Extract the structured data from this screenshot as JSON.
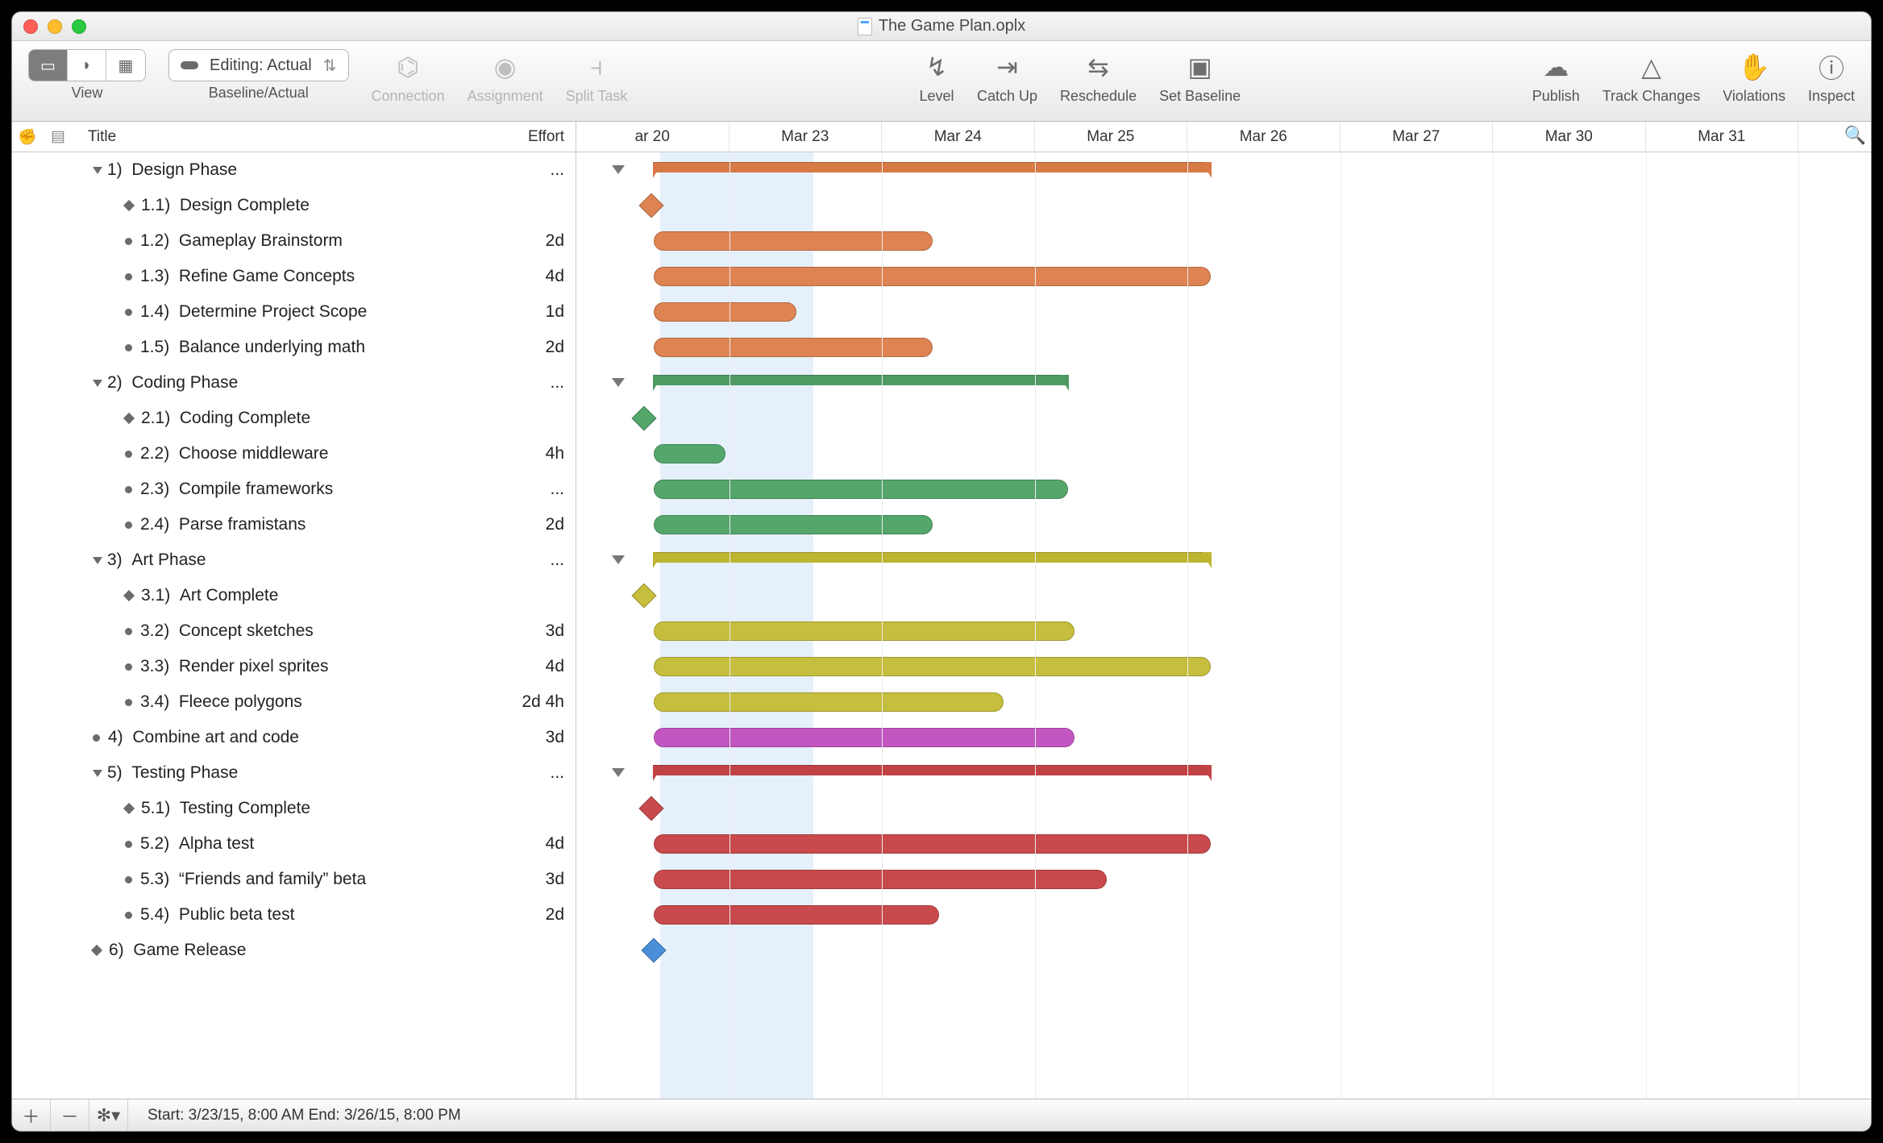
{
  "window_title": "The Game Plan.oplx",
  "toolbar": {
    "view_label": "View",
    "baseline_label": "Baseline/Actual",
    "dropdown_value": "Editing: Actual",
    "connection": "Connection",
    "assignment": "Assignment",
    "split": "Split Task",
    "level": "Level",
    "catch": "Catch Up",
    "reschedule": "Reschedule",
    "setbase": "Set Baseline",
    "publish": "Publish",
    "track": "Track Changes",
    "violations": "Violations",
    "inspect": "Inspect"
  },
  "columns": {
    "title": "Title",
    "effort": "Effort"
  },
  "dates": [
    "ar 20",
    "Mar 23",
    "Mar 24",
    "Mar 25",
    "Mar 26",
    "Mar 27",
    "Mar 30",
    "Mar 31"
  ],
  "tasks": [
    {
      "n": "1)",
      "t": "Design Phase",
      "eff": "...",
      "type": "group",
      "lvl": 0,
      "color": "orange",
      "start": 0.06,
      "end": 0.49
    },
    {
      "n": "1.1)",
      "t": "Design Complete",
      "eff": "",
      "type": "milestone",
      "lvl": 1,
      "color": "orange",
      "start": 0.058
    },
    {
      "n": "1.2)",
      "t": "Gameplay Brainstorm",
      "eff": "2d",
      "type": "task",
      "lvl": 1,
      "color": "orange",
      "start": 0.06,
      "end": 0.275
    },
    {
      "n": "1.3)",
      "t": "Refine Game Concepts",
      "eff": "4d",
      "type": "task",
      "lvl": 1,
      "color": "orange",
      "start": 0.06,
      "end": 0.49
    },
    {
      "n": "1.4)",
      "t": "Determine Project Scope",
      "eff": "1d",
      "type": "task",
      "lvl": 1,
      "color": "orange",
      "start": 0.06,
      "end": 0.17
    },
    {
      "n": "1.5)",
      "t": "Balance underlying math",
      "eff": "2d",
      "type": "task",
      "lvl": 1,
      "color": "orange",
      "start": 0.06,
      "end": 0.275
    },
    {
      "n": "2)",
      "t": "Coding Phase",
      "eff": "...",
      "type": "group",
      "lvl": 0,
      "color": "green",
      "start": 0.06,
      "end": 0.38
    },
    {
      "n": "2.1)",
      "t": "Coding Complete",
      "eff": "",
      "type": "milestone",
      "lvl": 1,
      "color": "green",
      "start": 0.052
    },
    {
      "n": "2.2)",
      "t": "Choose middleware",
      "eff": "4h",
      "type": "task",
      "lvl": 1,
      "color": "green",
      "start": 0.06,
      "end": 0.115
    },
    {
      "n": "2.3)",
      "t": "Compile frameworks",
      "eff": "...",
      "type": "task",
      "lvl": 1,
      "color": "green",
      "start": 0.06,
      "end": 0.38
    },
    {
      "n": "2.4)",
      "t": "Parse framistans",
      "eff": "2d",
      "type": "task",
      "lvl": 1,
      "color": "green",
      "start": 0.06,
      "end": 0.275
    },
    {
      "n": "3)",
      "t": "Art Phase",
      "eff": "...",
      "type": "group",
      "lvl": 0,
      "color": "olive",
      "start": 0.06,
      "end": 0.49
    },
    {
      "n": "3.1)",
      "t": "Art Complete",
      "eff": "",
      "type": "milestone",
      "lvl": 1,
      "color": "olive",
      "start": 0.052
    },
    {
      "n": "3.2)",
      "t": "Concept sketches",
      "eff": "3d",
      "type": "task",
      "lvl": 1,
      "color": "olive",
      "start": 0.06,
      "end": 0.385
    },
    {
      "n": "3.3)",
      "t": "Render pixel sprites",
      "eff": "4d",
      "type": "task",
      "lvl": 1,
      "color": "olive",
      "start": 0.06,
      "end": 0.49
    },
    {
      "n": "3.4)",
      "t": "Fleece polygons",
      "eff": "2d 4h",
      "type": "task",
      "lvl": 1,
      "color": "olive",
      "start": 0.06,
      "end": 0.33
    },
    {
      "n": "4)",
      "t": "Combine art and code",
      "eff": "3d",
      "type": "task",
      "lvl": 0,
      "color": "magenta",
      "start": 0.06,
      "end": 0.385,
      "leaf": true
    },
    {
      "n": "5)",
      "t": "Testing Phase",
      "eff": "...",
      "type": "group",
      "lvl": 0,
      "color": "red",
      "start": 0.06,
      "end": 0.49
    },
    {
      "n": "5.1)",
      "t": "Testing Complete",
      "eff": "",
      "type": "milestone",
      "lvl": 1,
      "color": "red",
      "start": 0.058
    },
    {
      "n": "5.2)",
      "t": "Alpha test",
      "eff": "4d",
      "type": "task",
      "lvl": 1,
      "color": "red",
      "start": 0.06,
      "end": 0.49
    },
    {
      "n": "5.3)",
      "t": "“Friends and family” beta",
      "eff": "3d",
      "type": "task",
      "lvl": 1,
      "color": "red",
      "start": 0.06,
      "end": 0.41
    },
    {
      "n": "5.4)",
      "t": "Public beta test",
      "eff": "2d",
      "type": "task",
      "lvl": 1,
      "color": "red",
      "start": 0.06,
      "end": 0.28
    },
    {
      "n": "6)",
      "t": "Game Release",
      "eff": "",
      "type": "milestone",
      "lvl": 0,
      "color": "blue",
      "start": 0.06,
      "leaf": true
    }
  ],
  "footer": {
    "status": "Start: 3/23/15, 8:00 AM End: 3/26/15, 8:00 PM"
  },
  "timeline": {
    "col_width_frac": 0.118,
    "today_start": 0.065,
    "today_end": 0.183
  }
}
